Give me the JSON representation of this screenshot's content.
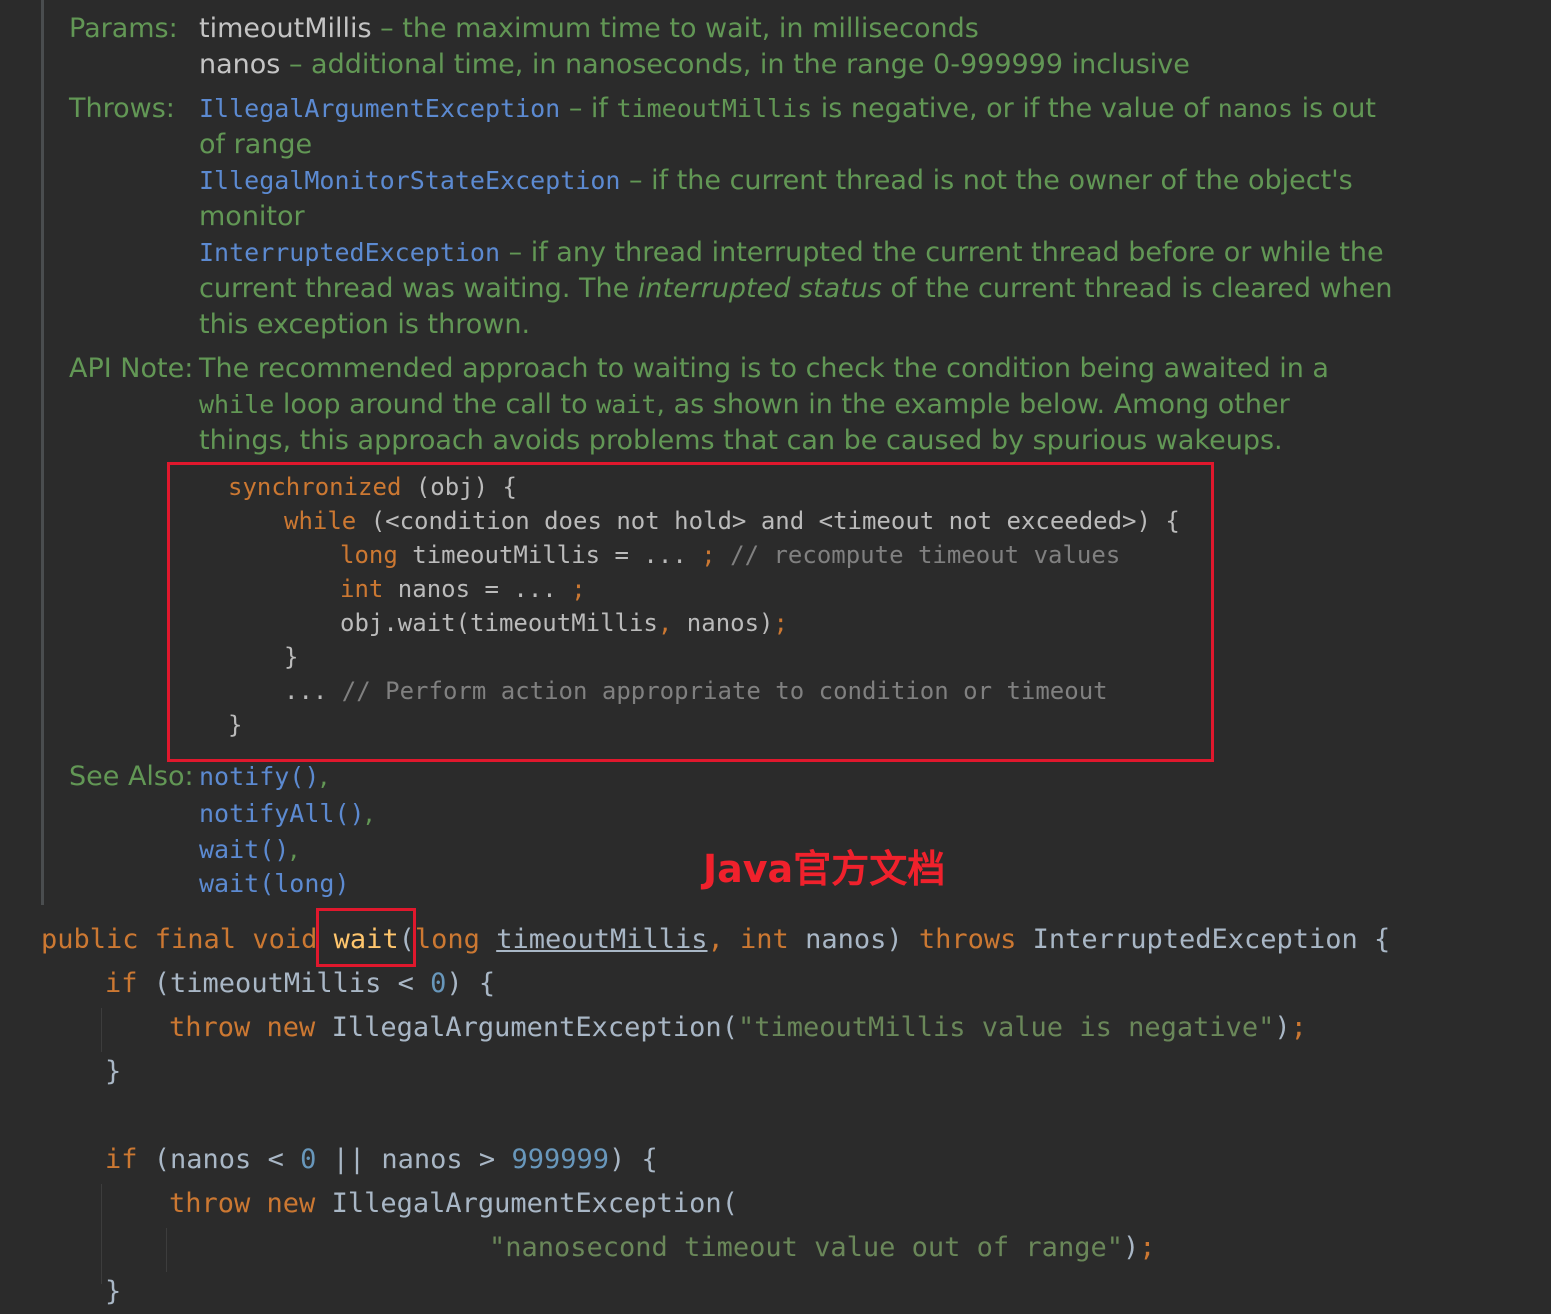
{
  "doc": {
    "params_label": "Params:",
    "param1_name": "timeoutMillis",
    "param1_desc": " – the maximum time to wait, in milliseconds",
    "param2_name": "nanos",
    "param2_desc": " – additional time, in nanoseconds, in the range 0-999999 inclusive",
    "throws_label": "Throws:",
    "ex1_name": "IllegalArgumentException",
    "ex1_desc_a": " – if ",
    "ex1_code1": "timeoutMillis",
    "ex1_desc_b": " is negative, or if the value of ",
    "ex1_code2": "nanos",
    "ex1_desc_c": " is out",
    "ex1_desc_line2": "of range",
    "ex2_name": "IllegalMonitorStateException",
    "ex2_desc": " – if the current thread is not the owner of the object's",
    "ex2_desc_line2": "monitor",
    "ex3_name": "InterruptedException",
    "ex3_desc": " – if any thread interrupted the current thread before or while the",
    "ex3_line2_a": "current thread was waiting. The ",
    "ex3_line2_italic": "interrupted status",
    "ex3_line2_b": " of the current thread is cleared when",
    "ex3_line3": "this exception is thrown.",
    "api_label": "API Note:",
    "api_line1": "The recommended approach to waiting is to check the condition being awaited in a",
    "api_line2_code1": "while",
    "api_line2_a": " loop around the call to ",
    "api_line2_code2": "wait",
    "api_line2_b": ", as shown in the example below. Among other",
    "api_line3": "things, this approach avoids problems that can be caused by spurious wakeups.",
    "see_label": "See Also:",
    "see_links": [
      "notify()",
      "notifyAll()",
      "wait()",
      "wait(long)"
    ],
    "see_sep": ","
  },
  "example": {
    "l1_kw": "synchronized",
    "l1_rest": " (obj) {",
    "l2_kw": "while",
    "l2_rest": " (<condition does not hold> and <timeout not exceeded>) {",
    "l3_kw": "long",
    "l3_rest": " timeoutMillis = ... ",
    "l3_semi": ";",
    "l3_comment": " // recompute timeout values",
    "l4_kw": "int",
    "l4_rest": " nanos = ... ",
    "l4_semi": ";",
    "l5_a": "obj.wait(timeoutMillis",
    "l5_comma": ",",
    "l5_b": " nanos)",
    "l5_semi": ";",
    "l6": "}",
    "l7_a": "... ",
    "l7_comment": "// Perform action appropriate to condition or timeout",
    "l8": "}"
  },
  "annotation": "Java官方文档",
  "code": {
    "sig_kw": "public final void ",
    "sig_method": "wait",
    "sig_paren": "(",
    "sig_kw2": "long ",
    "sig_param1": "timeoutMillis",
    "sig_comma": ", ",
    "sig_kw3": "int ",
    "sig_param2": "nanos) ",
    "sig_throws": "throws ",
    "sig_rest": "InterruptedException {",
    "if1_kw": "if ",
    "if1_a": "(timeoutMillis < ",
    "if1_num": "0",
    "if1_b": ") {",
    "throw1_kw": "throw new ",
    "throw1_cls": "IllegalArgumentException(",
    "throw1_str": "\"timeoutMillis value is negative\"",
    "throw1_end": ")",
    "throw1_semi": ";",
    "close1": "}",
    "if2_kw": "if ",
    "if2_a": "(nanos < ",
    "if2_num1": "0",
    "if2_b": " || nanos > ",
    "if2_num2": "999999",
    "if2_c": ") {",
    "throw2_kw": "throw new ",
    "throw2_cls": "IllegalArgumentException(",
    "throw2_str": "\"nanosecond timeout value out of range\"",
    "throw2_end": ")",
    "throw2_semi": ";",
    "close2": "}"
  },
  "colors": {
    "background": "#2b2b2b",
    "doc_text": "#629755",
    "link": "#5c8ad1",
    "keyword": "#cc7832",
    "string": "#6a8759",
    "number": "#6897bb",
    "method": "#ffc66d",
    "highlight_box": "#e0182d"
  }
}
